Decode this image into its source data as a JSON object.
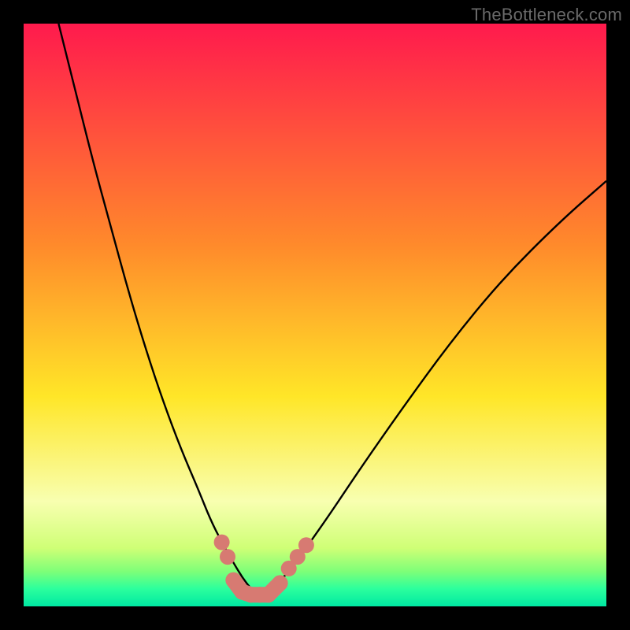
{
  "watermark": "TheBottleneck.com",
  "colors": {
    "top": "#ff1a4d",
    "mid_upper": "#ff8a2b",
    "mid": "#ffe628",
    "low_band": "#f8ffb0",
    "green1": "#cfff76",
    "green2": "#7eff78",
    "green3": "#2bff9d",
    "green4": "#00e8a2",
    "curve": "#000000",
    "marker": "#d77a72",
    "frame": "#000000"
  },
  "chart_data": {
    "type": "line",
    "title": "",
    "xlabel": "",
    "ylabel": "",
    "xlim": [
      0,
      100
    ],
    "ylim": [
      0,
      100
    ],
    "series": [
      {
        "name": "bottleneck-curve-left",
        "x": [
          6,
          9,
          12,
          15,
          18,
          21,
          24,
          27,
          30,
          32,
          34,
          36,
          37.5,
          39,
          40.5
        ],
        "y": [
          100,
          88,
          76,
          65,
          54,
          44,
          35,
          27,
          20,
          15,
          11,
          7.5,
          5,
          3,
          1.5
        ]
      },
      {
        "name": "bottleneck-curve-right",
        "x": [
          40.5,
          43,
          47,
          52,
          58,
          65,
          73,
          82,
          92,
          100
        ],
        "y": [
          1.5,
          3,
          8,
          15,
          24,
          34,
          45,
          56,
          66,
          73
        ]
      }
    ],
    "markers": {
      "name": "highlighted-range",
      "points": [
        {
          "x": 34,
          "y": 11
        },
        {
          "x": 35,
          "y": 8.5
        },
        {
          "x": 36,
          "y": 4.5
        },
        {
          "x": 37.5,
          "y": 2.5
        },
        {
          "x": 39,
          "y": 2
        },
        {
          "x": 40.5,
          "y": 2
        },
        {
          "x": 42,
          "y": 2
        },
        {
          "x": 44,
          "y": 4
        },
        {
          "x": 45.5,
          "y": 6.5
        },
        {
          "x": 47,
          "y": 8.5
        },
        {
          "x": 48.5,
          "y": 10.5
        }
      ]
    },
    "gradient_stops_pct": [
      {
        "offset": 0,
        "color": "top"
      },
      {
        "offset": 38,
        "color": "mid_upper"
      },
      {
        "offset": 64,
        "color": "mid"
      },
      {
        "offset": 82,
        "color": "low_band"
      },
      {
        "offset": 90,
        "color": "green1"
      },
      {
        "offset": 94,
        "color": "green2"
      },
      {
        "offset": 97,
        "color": "green3"
      },
      {
        "offset": 100,
        "color": "green4"
      }
    ]
  }
}
